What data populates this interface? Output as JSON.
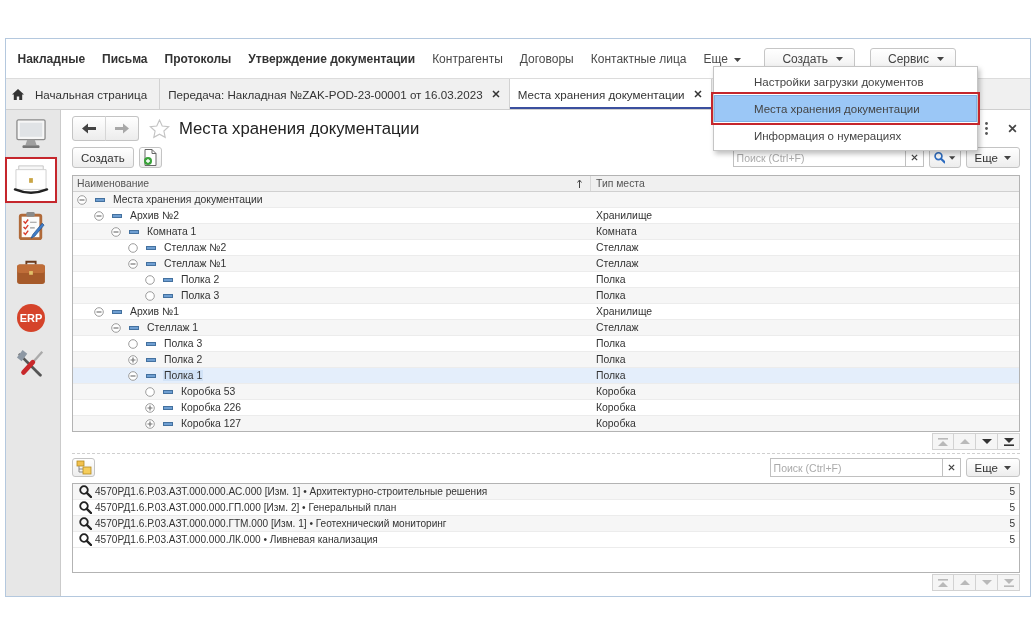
{
  "menu_bar": {
    "items": [
      {
        "label": "Накладные",
        "bold": true
      },
      {
        "label": "Письма",
        "bold": true
      },
      {
        "label": "Протоколы",
        "bold": true
      },
      {
        "label": "Утверждение документации",
        "bold": true
      },
      {
        "label": "Контрагенты",
        "bold": false
      },
      {
        "label": "Договоры",
        "bold": false
      },
      {
        "label": "Контактные лица",
        "bold": false
      }
    ],
    "more": {
      "label": "Еще",
      "menu": [
        {
          "label": "Настройки загрузки документов",
          "selected": false,
          "outlined": false
        },
        {
          "label": "Места хранения документации",
          "selected": true,
          "outlined": true
        },
        {
          "label": "Информация о нумерациях",
          "selected": false,
          "outlined": false
        }
      ]
    },
    "buttons": [
      {
        "label": "Создать"
      },
      {
        "label": "Сервис"
      }
    ]
  },
  "tabs": [
    {
      "kind": "home",
      "label": "Начальная страница",
      "selected": false
    },
    {
      "kind": "document",
      "label": "Передача: Накладная №ZAK-POD-23-00001 от 16.03.2023",
      "selected": false
    },
    {
      "kind": "document",
      "label": "Места хранения документации",
      "selected": true
    }
  ],
  "sidebar": {
    "items": [
      {
        "kind": "monitor",
        "selected": false,
        "outlined": false
      },
      {
        "kind": "documents",
        "selected": true,
        "outlined": true
      },
      {
        "kind": "clipboard",
        "selected": false,
        "outlined": false
      },
      {
        "kind": "briefcase",
        "selected": false,
        "outlined": false
      },
      {
        "kind": "erp",
        "label": "ERP",
        "selected": false,
        "outlined": false
      },
      {
        "kind": "tools",
        "selected": false,
        "outlined": false
      }
    ]
  },
  "form": {
    "nav_buttons": [
      {
        "kind": "back",
        "disabled": false
      },
      {
        "kind": "forward",
        "disabled": true
      }
    ],
    "favorite": false,
    "title": "Места хранения документации",
    "toolbar": {
      "create_button": "Создать",
      "search": {
        "placeholder": "Поиск (Ctrl+F)"
      },
      "more_button": "Еще"
    },
    "table": {
      "columns": [
        {
          "label": "Наименование",
          "sorted": true
        },
        {
          "label": "Тип места",
          "sorted": false
        }
      ],
      "rows": [
        {
          "label": "Места хранения документации",
          "kind": "group",
          "expanded": true,
          "selected": false,
          "children": [
            {
              "label": "Архив №2",
              "type": "Хранилище",
              "kind": "group",
              "expanded": true,
              "selected": false,
              "children": [
                {
                  "label": "Комната 1",
                  "type": "Комната",
                  "kind": "group",
                  "expanded": true,
                  "selected": false,
                  "children": [
                    {
                      "label": "Стеллаж №2",
                      "type": "Стеллаж",
                      "kind": "leaf",
                      "selected": false
                    },
                    {
                      "label": "Стеллаж №1",
                      "type": "Стеллаж",
                      "kind": "group",
                      "expanded": true,
                      "selected": false,
                      "children": [
                        {
                          "label": "Полка 2",
                          "type": "Полка",
                          "kind": "leaf",
                          "selected": false
                        },
                        {
                          "label": "Полка 3",
                          "type": "Полка",
                          "kind": "leaf",
                          "selected": false
                        }
                      ]
                    }
                  ]
                }
              ]
            },
            {
              "label": "Архив №1",
              "type": "Хранилище",
              "kind": "group",
              "expanded": true,
              "selected": false,
              "children": [
                {
                  "label": "Стеллаж 1",
                  "type": "Стеллаж",
                  "kind": "group",
                  "expanded": true,
                  "selected": false,
                  "children": [
                    {
                      "label": "Полка 3",
                      "type": "Полка",
                      "kind": "leaf",
                      "selected": false
                    },
                    {
                      "label": "Полка 2",
                      "type": "Полка",
                      "kind": "group",
                      "expanded": false,
                      "selected": false
                    },
                    {
                      "label": "Полка 1",
                      "type": "Полка",
                      "kind": "group",
                      "expanded": true,
                      "selected": true,
                      "children": [
                        {
                          "label": "Коробка 53",
                          "type": "Коробка",
                          "kind": "leaf",
                          "selected": false
                        },
                        {
                          "label": "Коробка 226",
                          "type": "Коробка",
                          "kind": "group",
                          "expanded": false,
                          "selected": false
                        },
                        {
                          "label": "Коробка 127",
                          "type": "Коробка",
                          "kind": "group",
                          "expanded": false,
                          "selected": false
                        }
                      ]
                    }
                  ]
                }
              ]
            }
          ]
        }
      ]
    },
    "scroll_buttons": [
      {
        "kind": "first",
        "disabled": true
      },
      {
        "kind": "up",
        "disabled": true
      },
      {
        "kind": "down",
        "disabled": false
      },
      {
        "kind": "last",
        "disabled": false
      }
    ]
  },
  "attachments": {
    "search": {
      "placeholder": "Поиск (Ctrl+F)"
    },
    "more_button": "Еще",
    "rows": [
      {
        "text": "4570РД1.6.Р.03.АЗТ.000.000.АС.000 [Изм. 1] • Архитектурно-строительные решения",
        "count": "5"
      },
      {
        "text": "4570РД1.6.Р.03.АЗТ.000.000.ГП.000 [Изм. 2] • Генеральный план",
        "count": "5"
      },
      {
        "text": "4570РД1.6.Р.03.АЗТ.000.000.ГТМ.000 [Изм. 1] • Геотехнический мониторинг",
        "count": "5"
      },
      {
        "text": "4570РД1.6.Р.03.АЗТ.000.000.ЛК.000 • Ливневая канализация",
        "count": "5"
      }
    ],
    "scroll_buttons": [
      {
        "kind": "first",
        "disabled": true
      },
      {
        "kind": "up",
        "disabled": true
      },
      {
        "kind": "down",
        "disabled": true
      },
      {
        "kind": "last",
        "disabled": true
      }
    ]
  }
}
